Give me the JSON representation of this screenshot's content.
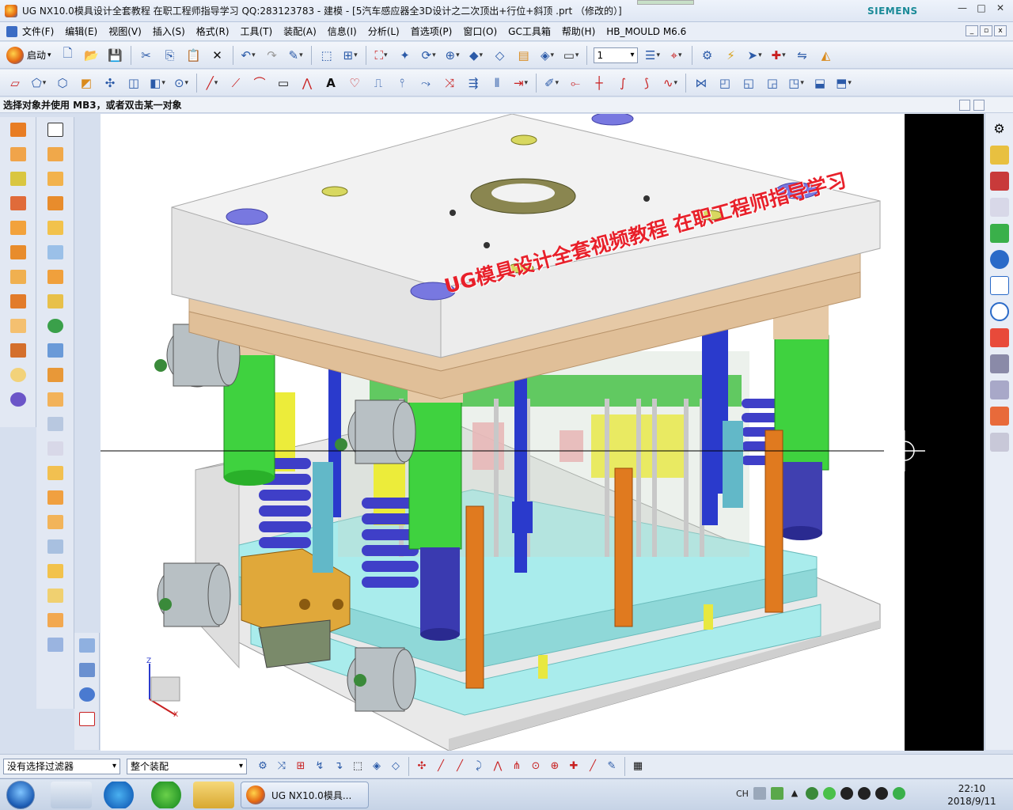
{
  "window": {
    "title": "UG NX10.0模具设计全套教程 在职工程师指导学习 QQ:283123783 - 建模 - [5汽车感应器全3D设计之二次顶出+行位+斜顶 .prt （修改的）]",
    "brand": "SIEMENS"
  },
  "menu": {
    "items": [
      "文件(F)",
      "编辑(E)",
      "视图(V)",
      "插入(S)",
      "格式(R)",
      "工具(T)",
      "装配(A)",
      "信息(I)",
      "分析(L)",
      "首选项(P)",
      "窗口(O)",
      "GC工具箱",
      "帮助(H)",
      "HB_MOULD M6.6"
    ]
  },
  "toolbar": {
    "start_label": "启动",
    "layer_value": "1"
  },
  "prompt": {
    "text": "选择对象并使用 MB3，或者双击某一对象"
  },
  "viewport": {
    "watermark": "UG模具设计全套视频教程 在职工程师指导学习",
    "axis_z": "Z",
    "axis_x": "X"
  },
  "bottombar": {
    "filter_value": "没有选择过滤器",
    "scope_value": "整个装配"
  },
  "taskbar": {
    "task_label": "UG NX10.0模具...",
    "ime": "CH",
    "time": "22:10",
    "date": "2018/9/11"
  },
  "colors": {
    "plate_white": "#f2f2f2",
    "plate_tan": "#e6c9a6",
    "pillar_green": "#3fd23f",
    "spring_blue": "#3f3fc8",
    "ejector_orange": "#e07a1f",
    "cyan_plate": "#a9ecec",
    "slide_orange": "#e0a83a",
    "watermark_red": "#e8202a"
  }
}
